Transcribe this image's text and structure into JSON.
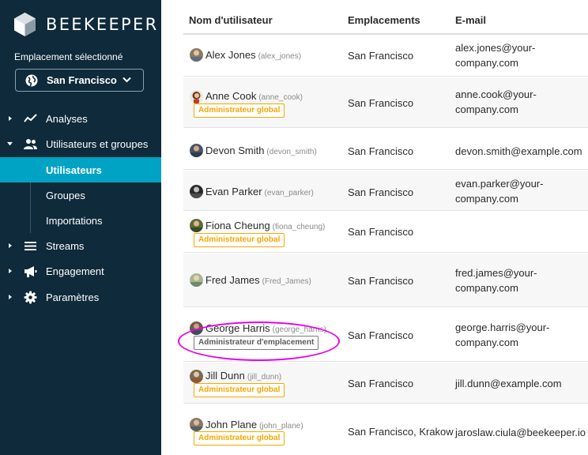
{
  "brand": {
    "name": "BEEKEEPER"
  },
  "location_selector": {
    "label": "Emplacement sélectionné",
    "value": "San Francisco"
  },
  "nav": {
    "analyses": "Analyses",
    "users_groups": "Utilisateurs et groupes",
    "users": "Utilisateurs",
    "groups": "Groupes",
    "imports": "Importations",
    "streams": "Streams",
    "engagement": "Engagement",
    "settings": "Paramètres"
  },
  "table": {
    "headers": {
      "name": "Nom d'utilisateur",
      "locations": "Emplacements",
      "email": "E-mail"
    },
    "rows": [
      {
        "name": "Alex Jones",
        "handle": "(alex_jones)",
        "badge": "",
        "location": "San Francisco",
        "email1": "alex.jones@your-",
        "email2": "company.com"
      },
      {
        "name": "Anne Cook",
        "handle": "(anne_cook)",
        "badge": "Administrateur global",
        "location": "San Francisco",
        "email1": "anne.cook@your-",
        "email2": "company.com"
      },
      {
        "name": "Devon Smith",
        "handle": "(devon_smith)",
        "badge": "",
        "location": "San Francisco",
        "email1": "devon.smith@example.com",
        "email2": ""
      },
      {
        "name": "Evan Parker",
        "handle": "(evan_parker)",
        "badge": "",
        "location": "San Francisco",
        "email1": "evan.parker@your-",
        "email2": "company.com"
      },
      {
        "name": "Fiona Cheung",
        "handle": "(fiona_cheung)",
        "badge": "Administrateur global",
        "location": "San Francisco",
        "email1": "",
        "email2": ""
      },
      {
        "name": "Fred James",
        "handle": "(Fred_James)",
        "badge": "",
        "location": "San Francisco",
        "email1": "fred.james@your-",
        "email2": "company.com"
      },
      {
        "name": "George Harris",
        "handle": "(george_harris)",
        "badge": "Administrateur d'emplacement",
        "location": "San Francisco",
        "email1": "george.harris@your-",
        "email2": "company.com"
      },
      {
        "name": "Jill Dunn",
        "handle": "(jill_dunn)",
        "badge": "Administrateur global",
        "location": "San Francisco",
        "email1": "jill.dunn@example.com",
        "email2": ""
      },
      {
        "name": "John Plane",
        "handle": "(john_plane)",
        "badge": "Administrateur global",
        "location": "San Francisco, Krakow",
        "email1": "jaroslaw.ciula@beekeeper.io",
        "email2": ""
      }
    ]
  },
  "colors": {
    "sidebar_bg": "#0e2a3b",
    "active_item": "#00a3c4",
    "global_admin_badge": "#f5a800",
    "highlight_ring": "#e800e8"
  },
  "icons": [
    "beekeeper-logo-icon",
    "globe-icon",
    "chevron-down-icon",
    "caret-right-icon",
    "caret-down-icon",
    "analytics-icon",
    "users-icon",
    "streams-icon",
    "megaphone-icon",
    "gear-icon"
  ]
}
